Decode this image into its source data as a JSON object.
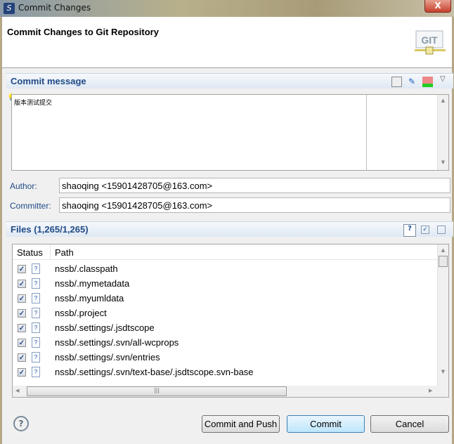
{
  "window": {
    "title": "Commit Changes",
    "close_label": "X"
  },
  "header": {
    "title": "Commit Changes to Git Repository",
    "logo_text": "GIT"
  },
  "commit_message": {
    "section_title": "Commit message",
    "text": "版本测试提交"
  },
  "author": {
    "label": "Author:",
    "value": "shaoqing <15901428705@163.com>"
  },
  "committer": {
    "label": "Committer:",
    "value": "shaoqing <15901428705@163.com>"
  },
  "files": {
    "section_title": "Files (1,265/1,265)",
    "columns": [
      "Status",
      "Path"
    ],
    "rows": [
      {
        "checked": true,
        "icon": "untracked-file-icon",
        "path": "nssb/.classpath"
      },
      {
        "checked": true,
        "icon": "untracked-file-icon",
        "path": "nssb/.mymetadata"
      },
      {
        "checked": true,
        "icon": "untracked-file-icon",
        "path": "nssb/.myumldata"
      },
      {
        "checked": true,
        "icon": "untracked-file-icon",
        "path": "nssb/.project"
      },
      {
        "checked": true,
        "icon": "untracked-file-icon",
        "path": "nssb/.settings/.jsdtscope"
      },
      {
        "checked": true,
        "icon": "untracked-file-icon",
        "path": "nssb/.settings/.svn/all-wcprops"
      },
      {
        "checked": true,
        "icon": "untracked-file-icon",
        "path": "nssb/.settings/.svn/entries"
      },
      {
        "checked": true,
        "icon": "untracked-file-icon",
        "path": "nssb/.settings/.svn/text-base/.jsdtscope.svn-base"
      }
    ]
  },
  "buttons": {
    "help": "?",
    "commit_and_push": "Commit and Push",
    "commit": "Commit",
    "cancel": "Cancel"
  },
  "colors": {
    "section_title": "#1f4a86",
    "default_button_border": "#3c7fb1"
  }
}
